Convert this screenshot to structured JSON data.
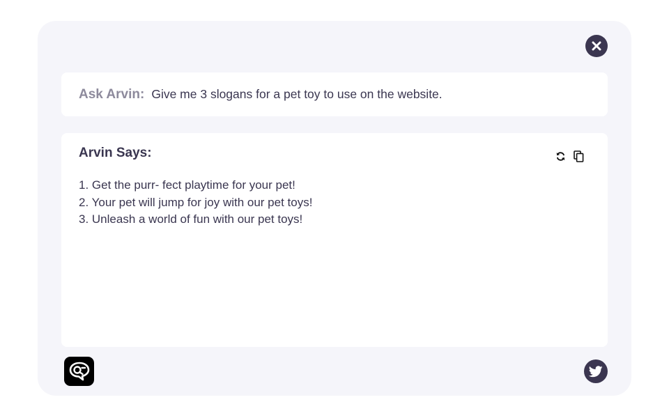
{
  "ask": {
    "label": "Ask Arvin:",
    "query": "Give me 3 slogans for a pet toy to use on the website."
  },
  "answer": {
    "title": "Arvin Says:",
    "lines": [
      "1. Get the purr- fect playtime for your pet!",
      "2. Your pet will jump for joy with our pet toys!",
      "3. Unleash a world of fun with our pet toys!"
    ]
  },
  "icons": {
    "close": "close-icon",
    "refresh": "refresh-icon",
    "copy": "copy-icon",
    "logo": "arvin-logo-icon",
    "twitter": "twitter-icon"
  },
  "colors": {
    "panel_background": "#f5f5fa",
    "card_background": "#ffffff",
    "text_primary": "#3a3650",
    "text_muted": "#8d8a9c",
    "button_dark": "#3b3650"
  }
}
